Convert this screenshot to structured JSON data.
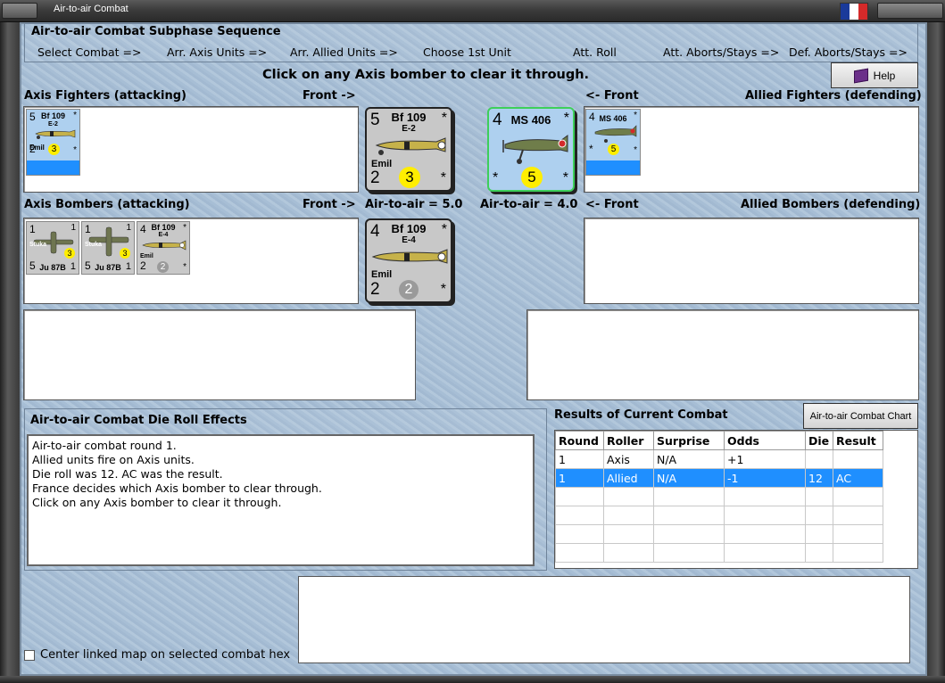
{
  "window": {
    "title": "Air-to-air Combat",
    "flag_colors": [
      "#1a3a9a",
      "#ffffff",
      "#d42a2a"
    ]
  },
  "sequence": {
    "header": "Air-to-air Combat Subphase Sequence",
    "steps": [
      "Select Combat =>",
      "Arr. Axis Units =>",
      "Arr. Allied Units =>",
      "Choose 1st Unit",
      "Att. Roll",
      "Att. Aborts/Stays =>",
      "Def. Aborts/Stays =>"
    ]
  },
  "instruction": "Click on any Axis bomber to clear it through.",
  "help_label": "Help",
  "labels": {
    "axis_fighters": "Axis Fighters (attacking)",
    "front_right_1": "Front ->",
    "front_left_1": "<- Front",
    "allied_fighters": "Allied Fighters (defending)",
    "axis_bombers": "Axis Bombers (attacking)",
    "front_right_2": "Front ->",
    "axis_air_to_air": "Air-to-air = 5.0",
    "allied_air_to_air": "Air-to-air = 4.0",
    "front_left_2": "<- Front",
    "allied_bombers": "Allied Bombers (defending)"
  },
  "axis_fighter_counter": {
    "tl": "5",
    "tr": "*",
    "name": "Bf 109",
    "sub": "E-2",
    "pilot": "Emil",
    "bl": "2",
    "badge": "3",
    "br": "*"
  },
  "axis_bomber_counters": [
    {
      "tl": "1",
      "tr": "1",
      "mid": "Stuka",
      "badge": "3",
      "bl": "5",
      "name": "Ju 87B",
      "br": "1"
    },
    {
      "tl": "1",
      "tr": "1",
      "mid": "Stuka",
      "badge": "3",
      "bl": "5",
      "name": "Ju 87B",
      "br": "1"
    },
    {
      "tl": "4",
      "tr": "*",
      "name": "Bf 109",
      "sub": "E-4",
      "pilot": "Emil",
      "bl": "2",
      "badge": "2",
      "br": "*"
    }
  ],
  "big_axis_fighter": {
    "tl": "5",
    "tr": "*",
    "name": "Bf 109",
    "sub": "E-2",
    "pilot": "Emil",
    "bl": "2",
    "badge": "3",
    "br": "*"
  },
  "big_axis_bomber": {
    "tl": "4",
    "tr": "*",
    "name": "Bf 109",
    "sub": "E-4",
    "pilot": "Emil",
    "bl": "2",
    "badge": "2",
    "br": "*"
  },
  "big_allied_fighter": {
    "tl": "4",
    "tr": "*",
    "name": "MS 406",
    "bl": "*",
    "badge": "5",
    "br": "*"
  },
  "allied_fighter_counter": {
    "tl": "4",
    "tr": "*",
    "name": "MS 406",
    "bl": "*",
    "badge": "5",
    "br": "*"
  },
  "effects": {
    "header": "Air-to-air Combat Die Roll Effects",
    "lines": [
      "Air-to-air combat round 1.",
      "Allied units fire on Axis units.",
      "Die roll was 12.  AC was the result.",
      "France decides which Axis bomber to clear through.",
      "Click on any Axis bomber to clear it through."
    ]
  },
  "results": {
    "header": "Results of Current Combat",
    "chart_button": "Air-to-air Combat Chart",
    "columns": [
      "Round",
      "Roller",
      "Surprise",
      "Odds",
      "Die",
      "Result"
    ],
    "rows": [
      [
        "1",
        "Axis",
        "N/A",
        "+1",
        "",
        ""
      ],
      [
        "1",
        "Allied",
        "N/A",
        "-1",
        "12",
        "AC"
      ]
    ],
    "empty_rows": 4
  },
  "checkbox_label": "Center linked map on selected combat hex",
  "colors": {
    "selected_row": "#1f8fff",
    "badge_yellow": "#ffee00",
    "allied_counter": "#aed0ef",
    "axis_counter": "#c8c8c8",
    "active_border": "#3ecf5a"
  }
}
